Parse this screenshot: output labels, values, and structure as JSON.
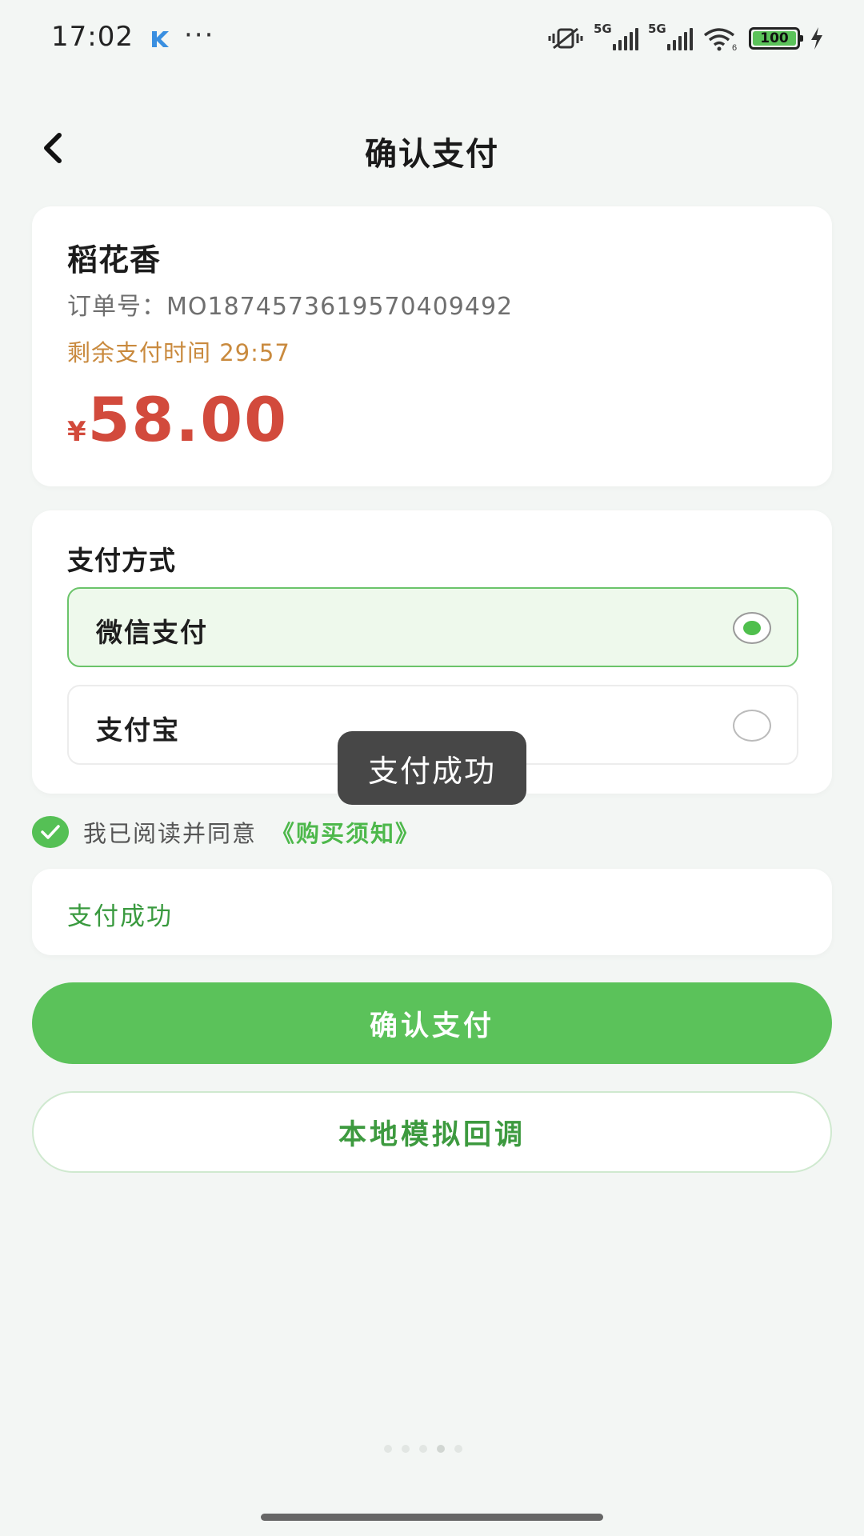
{
  "status_bar": {
    "time": "17:02",
    "app_icon": "k-app-icon",
    "more_dots": "···",
    "signal1_tag": "5G",
    "signal2_tag": "5G",
    "wifi_icon": "wifi-icon",
    "mute_icon": "vibrate-mute-icon",
    "battery_level": "100",
    "charging_icon": "charging-bolt-icon"
  },
  "header": {
    "back_icon": "chevron-left-icon",
    "title": "确认支付"
  },
  "order": {
    "product_name": "稻花香",
    "order_no_label": "订单号：",
    "order_no": "MO1874573619570409492",
    "remain_label": "剩余支付时间",
    "remain_time": "29:57",
    "currency_symbol": "¥",
    "amount": "58.00"
  },
  "payment": {
    "title": "支付方式",
    "options": [
      {
        "label": "微信支付",
        "selected": true
      },
      {
        "label": "支付宝",
        "selected": false
      }
    ]
  },
  "toast": {
    "text": "支付成功"
  },
  "agreement": {
    "checked": true,
    "text": "我已阅读并同意",
    "link": "《购买须知》"
  },
  "result": {
    "text": "支付成功"
  },
  "buttons": {
    "confirm": "确认支付",
    "callback": "本地模拟回调"
  },
  "colors": {
    "accent_green": "#5bc25a",
    "price_red": "#d24a3c",
    "timer_orange": "#c98a3e",
    "background": "#f3f6f4"
  }
}
